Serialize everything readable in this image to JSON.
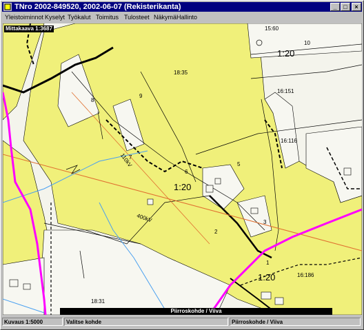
{
  "window": {
    "title": "TNro 2002-849520, 2002-06-07 (Rekisterikanta)",
    "controls": [
      "_",
      "□",
      "×"
    ]
  },
  "menu": [
    "Yleistoiminnot",
    "Kyselyt",
    "Työkalut",
    "Toimitus",
    "Tulosteet",
    "Näkymä",
    "Hallinto"
  ],
  "map": {
    "scale_label": "Mittakaava 1:3687",
    "parcel_labels": [
      "15:60",
      "10",
      "1:20",
      "18:35",
      "9",
      "8",
      "16:151",
      "16:116",
      "7",
      "110kV",
      "6",
      "1:20",
      "5",
      "400kV",
      "3",
      "2",
      "1",
      "1:20",
      "16:186",
      "18:31"
    ],
    "colors": {
      "parcel_fill": "#f0f07a",
      "road": "#ff00ff",
      "waterway": "#4aa0f0",
      "powerline": "#e07030",
      "boundary": "#000000"
    }
  },
  "statusbar": {
    "overlay": "Piirroskohde / Viiva",
    "scale": "Kuvaus 1:5000",
    "mode": "Valitse kohde",
    "object": "Piirroskohde / Viiva"
  }
}
